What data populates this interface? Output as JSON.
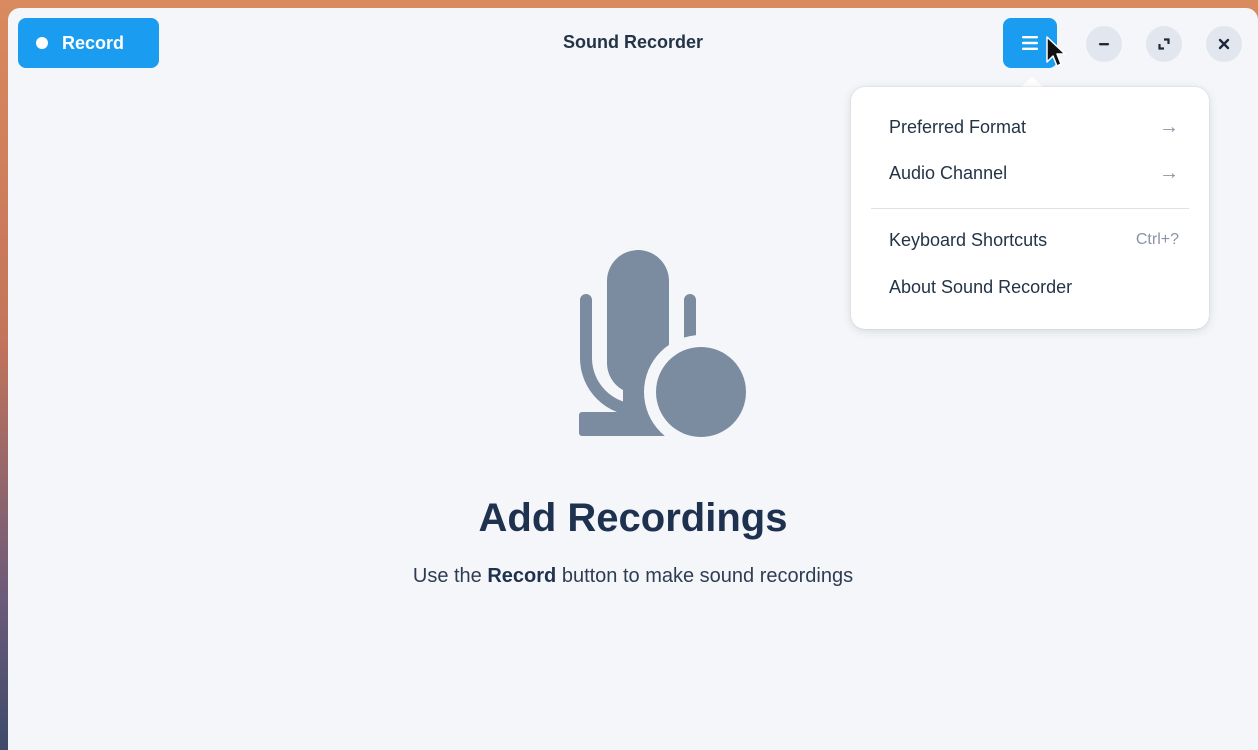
{
  "titlebar": {
    "record_label": "Record",
    "title": "Sound Recorder"
  },
  "menu": {
    "items": [
      {
        "label": "Preferred Format",
        "icon": "arrow-right-icon"
      },
      {
        "label": "Audio Channel",
        "icon": "arrow-right-icon"
      },
      {
        "label": "Keyboard Shortcuts",
        "shortcut": "Ctrl+?"
      },
      {
        "label": "About Sound Recorder"
      }
    ]
  },
  "empty_state": {
    "icon": "microphone-record-icon",
    "title": "Add Recordings",
    "desc_before": "Use the ",
    "desc_bold": "Record",
    "desc_after": " button to make sound recordings"
  },
  "colors": {
    "accent": "#1a9cf0",
    "icon_gray": "#7b8ca0",
    "heading": "#1e3250"
  }
}
